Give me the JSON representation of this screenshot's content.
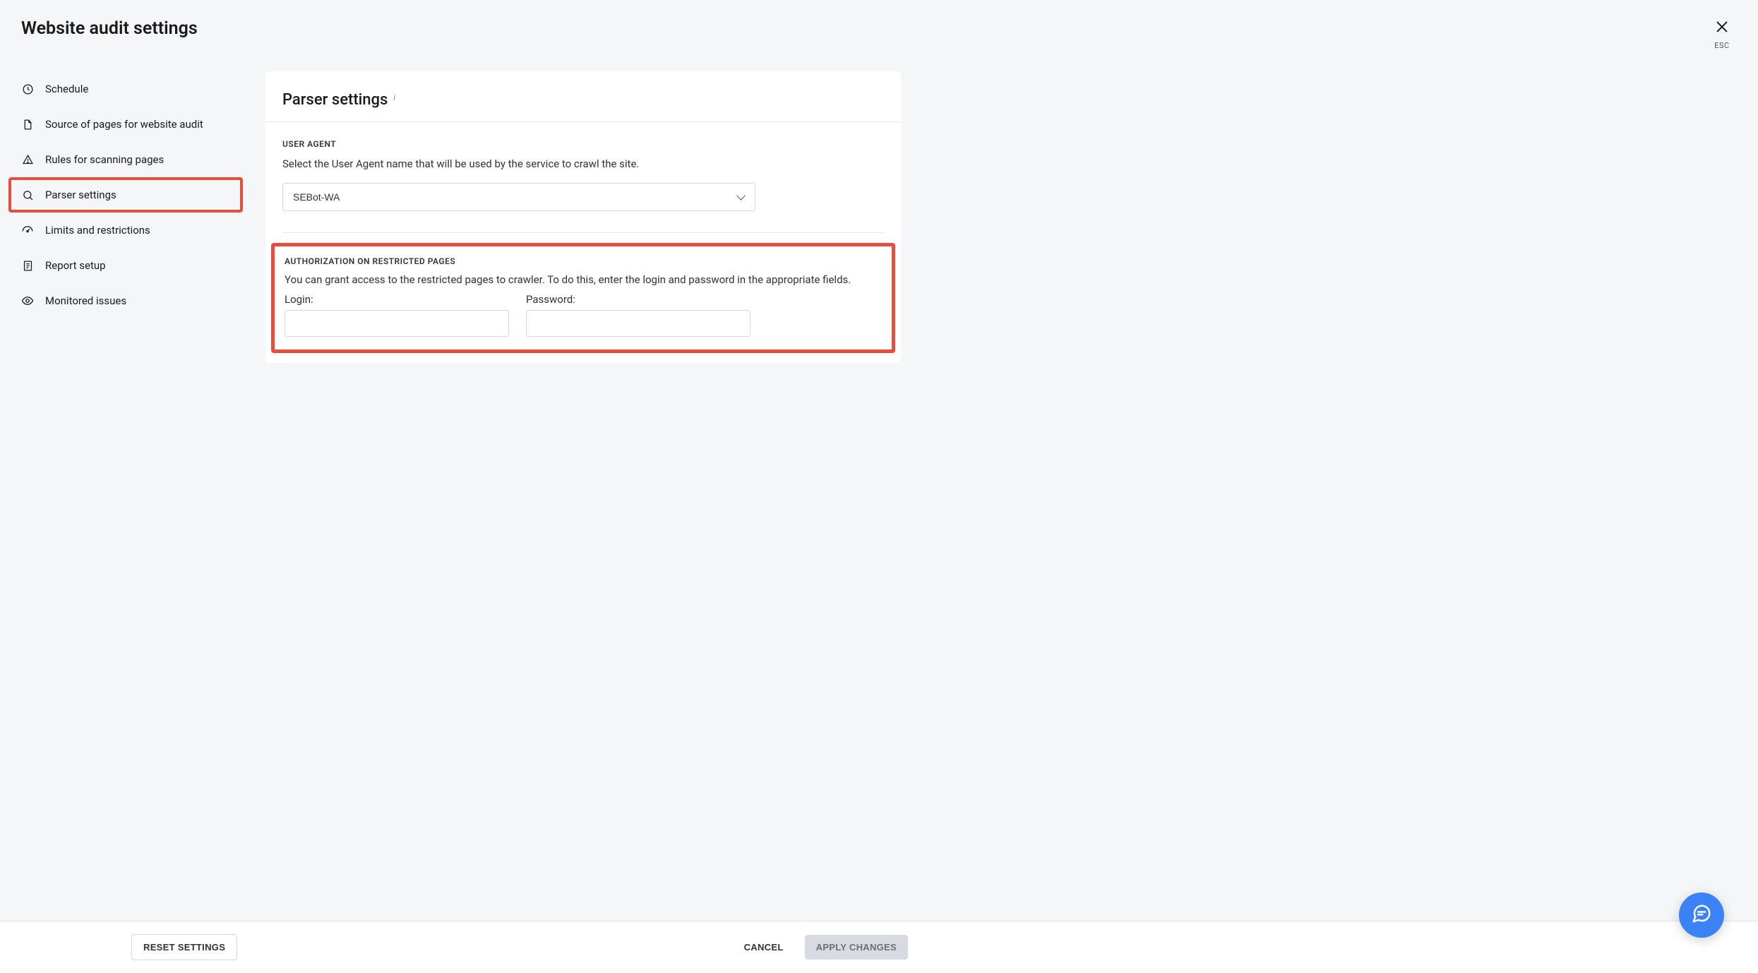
{
  "header": {
    "title": "Website audit settings",
    "close_label": "ESC"
  },
  "sidebar": {
    "items": [
      {
        "label": "Schedule"
      },
      {
        "label": "Source of pages for website audit"
      },
      {
        "label": "Rules for scanning pages"
      },
      {
        "label": "Parser settings",
        "active": true
      },
      {
        "label": "Limits and restrictions"
      },
      {
        "label": "Report setup"
      },
      {
        "label": "Monitored issues"
      }
    ]
  },
  "main": {
    "title": "Parser settings",
    "user_agent": {
      "section_label": "USER AGENT",
      "description": "Select the User Agent name that will be used by the service to crawl the site.",
      "selected": "SEBot-WA"
    },
    "auth": {
      "section_label": "AUTHORIZATION ON RESTRICTED PAGES",
      "description": "You can grant access to the restricted pages to crawler. To do this, enter the login and password in the appropriate fields.",
      "login_label": "Login:",
      "login_value": "",
      "password_label": "Password:",
      "password_value": ""
    }
  },
  "footer": {
    "reset": "RESET SETTINGS",
    "cancel": "CANCEL",
    "apply": "APPLY CHANGES"
  }
}
